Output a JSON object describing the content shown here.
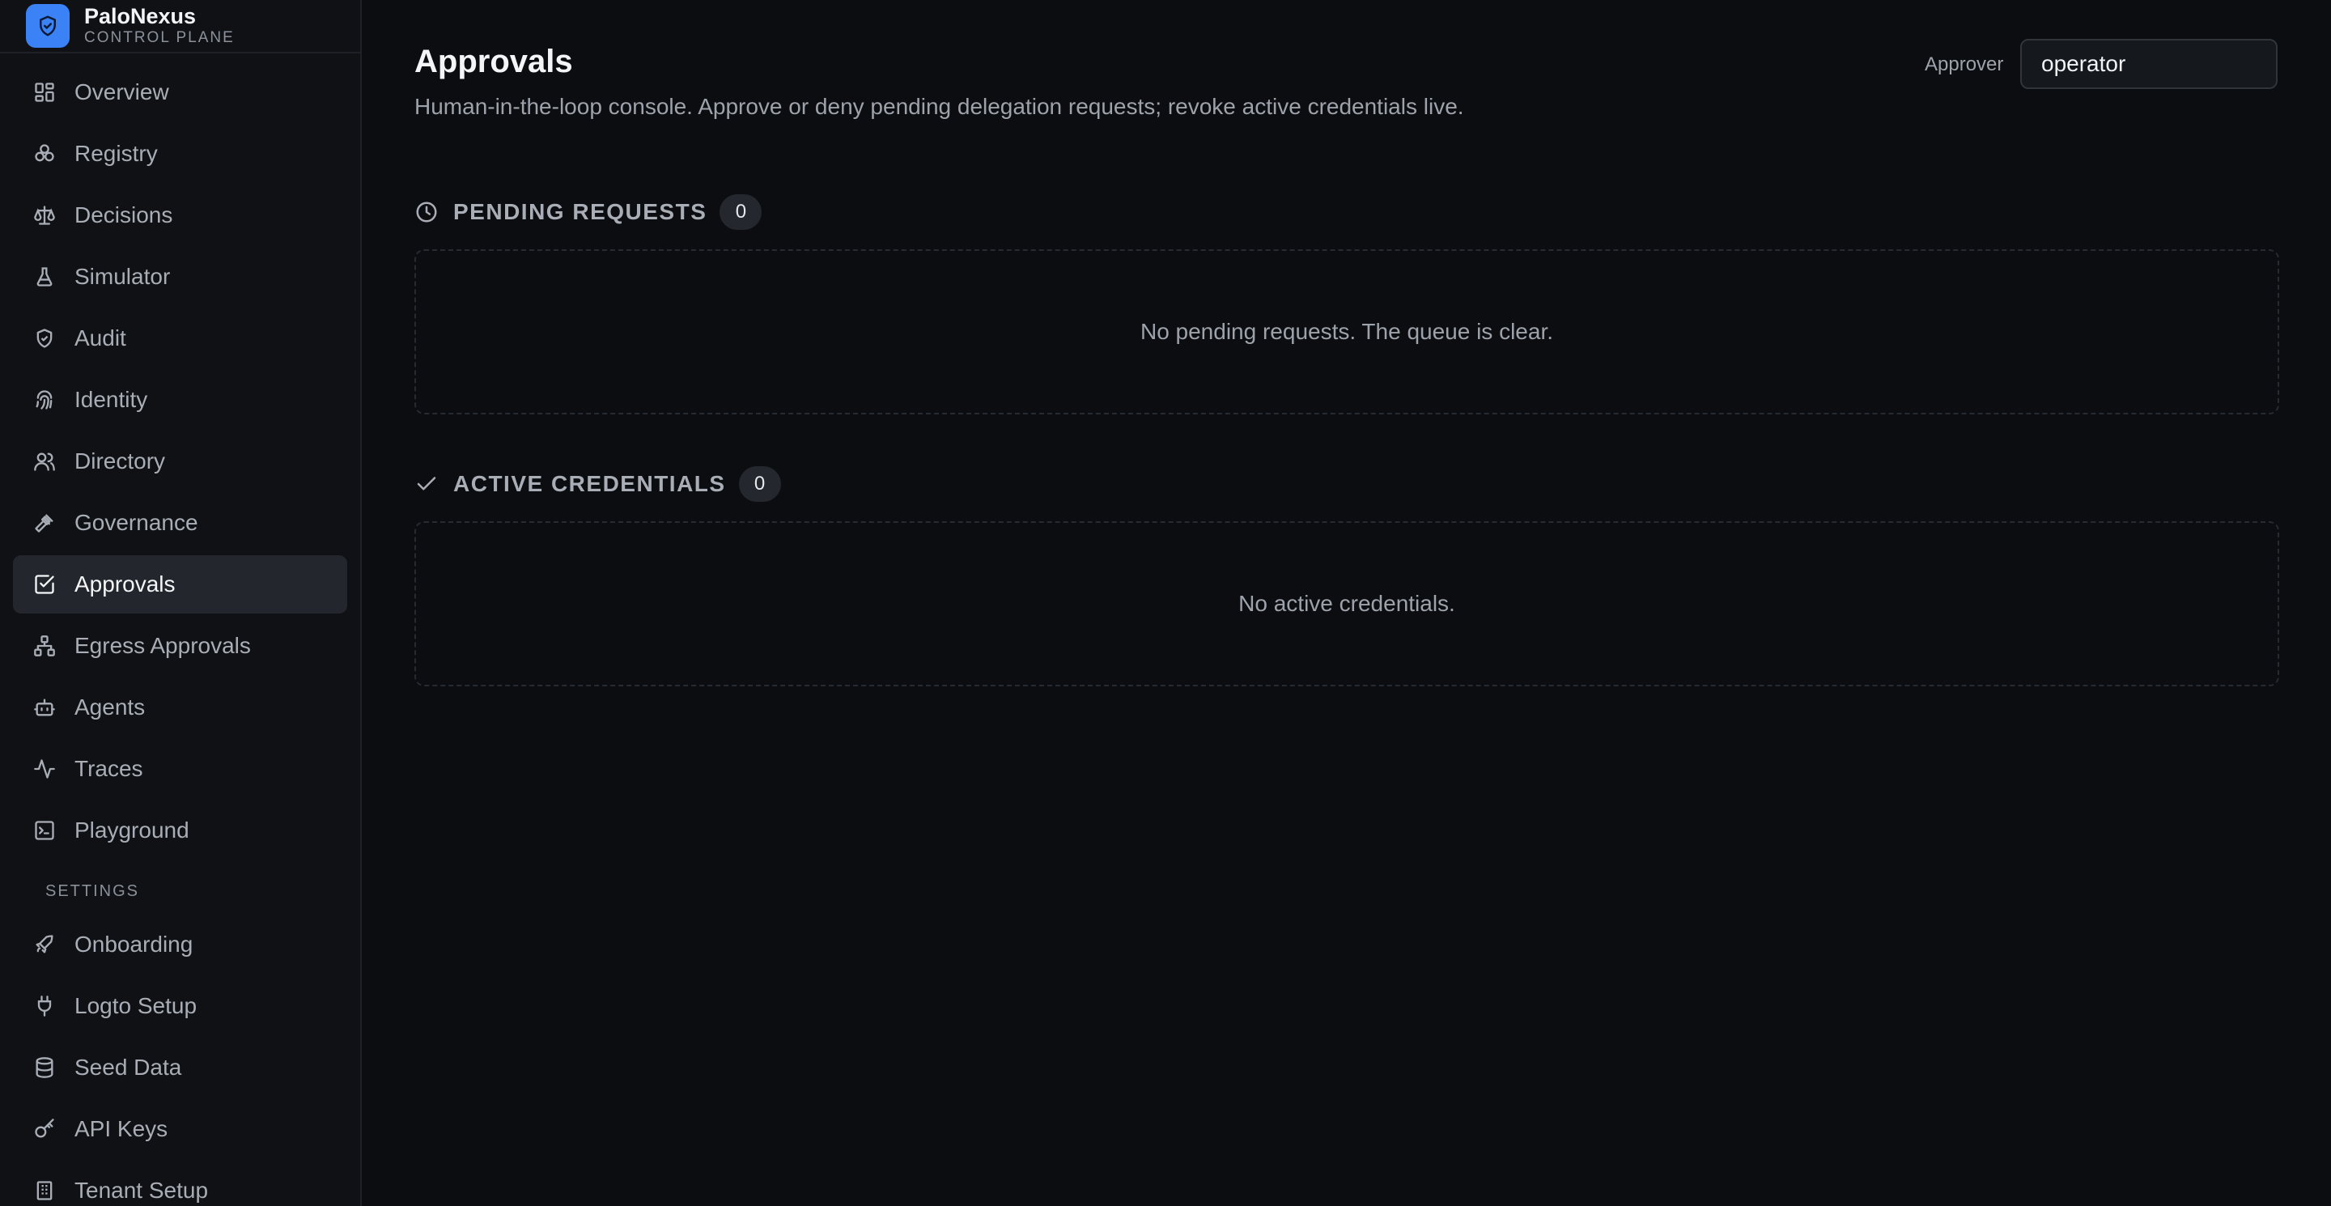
{
  "brand": {
    "name": "PaloNexus",
    "subtitle": "CONTROL PLANE"
  },
  "sidebar": {
    "items": [
      {
        "label": "Overview",
        "icon": "dashboard-icon"
      },
      {
        "label": "Registry",
        "icon": "registry-icon"
      },
      {
        "label": "Decisions",
        "icon": "scale-icon"
      },
      {
        "label": "Simulator",
        "icon": "flask-icon"
      },
      {
        "label": "Audit",
        "icon": "shield-check-icon"
      },
      {
        "label": "Identity",
        "icon": "fingerprint-icon"
      },
      {
        "label": "Directory",
        "icon": "users-icon"
      },
      {
        "label": "Governance",
        "icon": "gavel-icon"
      },
      {
        "label": "Approvals",
        "icon": "check-square-icon",
        "active": true
      },
      {
        "label": "Egress Approvals",
        "icon": "network-icon"
      },
      {
        "label": "Agents",
        "icon": "bot-icon"
      },
      {
        "label": "Traces",
        "icon": "activity-icon"
      },
      {
        "label": "Playground",
        "icon": "terminal-icon"
      }
    ],
    "settings_label": "SETTINGS",
    "settings_items": [
      {
        "label": "Onboarding",
        "icon": "rocket-icon"
      },
      {
        "label": "Logto Setup",
        "icon": "plug-icon"
      },
      {
        "label": "Seed Data",
        "icon": "database-icon"
      },
      {
        "label": "API Keys",
        "icon": "key-icon"
      },
      {
        "label": "Tenant Setup",
        "icon": "building-icon"
      }
    ]
  },
  "page": {
    "title": "Approvals",
    "description": "Human-in-the-loop console. Approve or deny pending delegation requests; revoke active credentials live.",
    "approver_label": "Approver",
    "approver_value": "operator"
  },
  "pending": {
    "title": "PENDING REQUESTS",
    "count": "0",
    "empty_text": "No pending requests. The queue is clear."
  },
  "active": {
    "title": "ACTIVE CREDENTIALS",
    "count": "0",
    "empty_text": "No active credentials."
  },
  "colors": {
    "accent": "#3b82f6",
    "background": "#0b0d11",
    "sidebar": "#0f1115",
    "active_item": "#23262c"
  }
}
